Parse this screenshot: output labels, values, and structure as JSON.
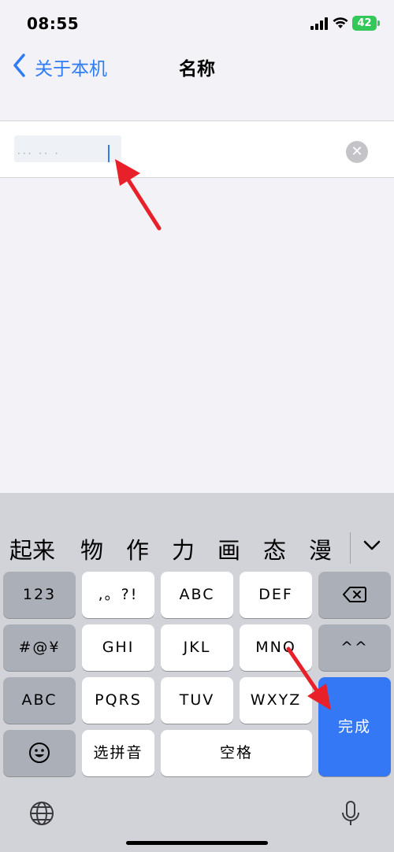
{
  "status_bar": {
    "time": "08:55",
    "battery": "42"
  },
  "nav": {
    "back_label": "关于本机",
    "title": "名称"
  },
  "name_field": {
    "value": "",
    "placeholder": "",
    "blurred_hint": "··· ·· ·"
  },
  "keyboard": {
    "candidates": [
      "起来",
      "物",
      "作",
      "力",
      "画",
      "态",
      "漫"
    ],
    "keys": {
      "k123": "123",
      "punct": ",。?!",
      "abc": "ABC",
      "def": "DEF",
      "sym": "#@¥",
      "ghi": "GHI",
      "jkl": "JKL",
      "mno": "MNO",
      "face": "^^",
      "abc_switch": "ABC",
      "pqrs": "PQRS",
      "tuv": "TUV",
      "wxyz": "WXYZ",
      "done": "完成",
      "pinyin": "选拼音",
      "space": "空格"
    }
  },
  "colors": {
    "accent": "#3478f6",
    "annotation_arrow": "#e8202a"
  },
  "icons": [
    "chevron-left-icon",
    "signal-icon",
    "wifi-icon",
    "battery-icon",
    "clear-icon",
    "backspace-icon",
    "emoji-icon",
    "globe-icon",
    "microphone-icon",
    "chevron-down-icon"
  ]
}
